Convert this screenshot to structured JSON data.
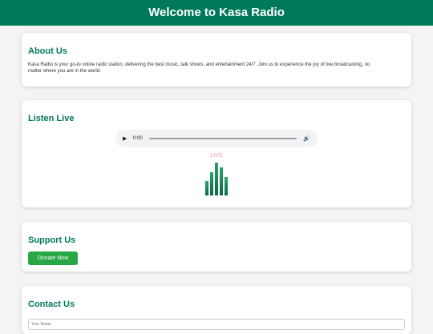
{
  "header": {
    "title": "Welcome to Kasa Radio"
  },
  "about": {
    "title": "About Us",
    "text": "Kasa Radio is your go-to online radio station, delivering the best music, talk shows, and entertainment 24/7. Join us to experience the joy of live broadcasting, no matter where you are in the world."
  },
  "listen": {
    "title": "Listen Live",
    "player": {
      "time": "0:00",
      "play_icon": "play-icon",
      "volume_icon": "volume-icon"
    },
    "live_label": "LIVE",
    "equalizer_levels": [
      0.45,
      0.7,
      1.0,
      0.85,
      0.55
    ]
  },
  "support": {
    "title": "Support Us",
    "donate_label": "Donate Now"
  },
  "contact": {
    "title": "Contact Us",
    "name_placeholder": "Your Name"
  },
  "colors": {
    "brand": "#00795a",
    "donate": "#28a745",
    "live": "#f5c0ce"
  }
}
